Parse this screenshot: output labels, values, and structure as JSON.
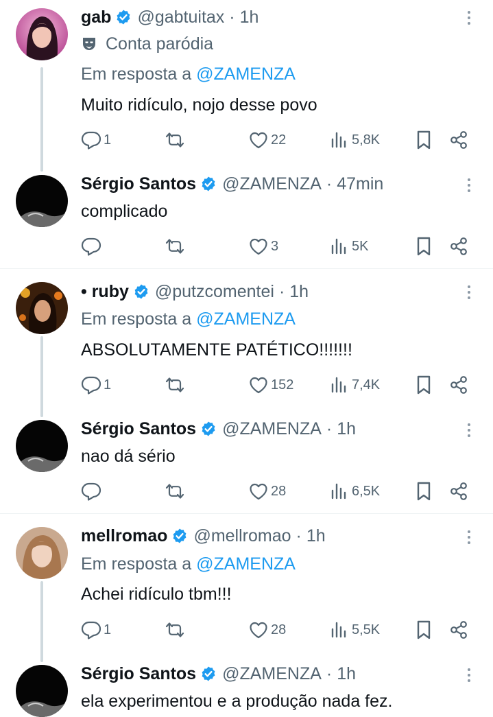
{
  "tweets": [
    {
      "name": "gab",
      "handle": "@gabtuitax",
      "time": "1h",
      "parody_label": "Conta paródia",
      "reply_prefix": "Em resposta a",
      "reply_mention": "@ZAMENZA",
      "text": "Muito ridículo, nojo desse povo",
      "replies": "1",
      "likes": "22",
      "views": "5,8K"
    },
    {
      "name": "Sérgio Santos",
      "handle": "@ZAMENZA",
      "time": "47min",
      "text": "complicado",
      "replies": "",
      "likes": "3",
      "views": "5K"
    },
    {
      "name": "• ruby",
      "handle": "@putzcomentei",
      "time": "1h",
      "reply_prefix": "Em resposta a",
      "reply_mention": "@ZAMENZA",
      "text": "ABSOLUTAMENTE PATÉTICO!!!!!!!",
      "replies": "1",
      "likes": "152",
      "views": "7,4K"
    },
    {
      "name": "Sérgio Santos",
      "handle": "@ZAMENZA",
      "time": "1h",
      "text": "nao dá sério",
      "replies": "",
      "likes": "28",
      "views": "6,5K"
    },
    {
      "name": "mellromao",
      "handle": "@mellromao",
      "time": "1h",
      "reply_prefix": "Em resposta a",
      "reply_mention": "@ZAMENZA",
      "text": "Achei ridículo tbm!!!",
      "replies": "1",
      "likes": "28",
      "views": "5,5K"
    },
    {
      "name": "Sérgio Santos",
      "handle": "@ZAMENZA",
      "time": "1h",
      "text": "ela experimentou e a produção nada fez."
    }
  ],
  "icons": {
    "verified": "verified-badge-icon",
    "parody": "parody-mask-icon",
    "reply": "reply-icon",
    "retweet": "retweet-icon",
    "like": "heart-icon",
    "views": "views-icon",
    "bookmark": "bookmark-icon",
    "share": "share-icon",
    "more": "more-vertical-icon"
  },
  "colors": {
    "text": "#0f1419",
    "secondary": "#536471",
    "link": "#1d9bf0",
    "verified": "#1d9bf0",
    "divider": "#eff3f4",
    "thread_line": "#cfd9de"
  }
}
